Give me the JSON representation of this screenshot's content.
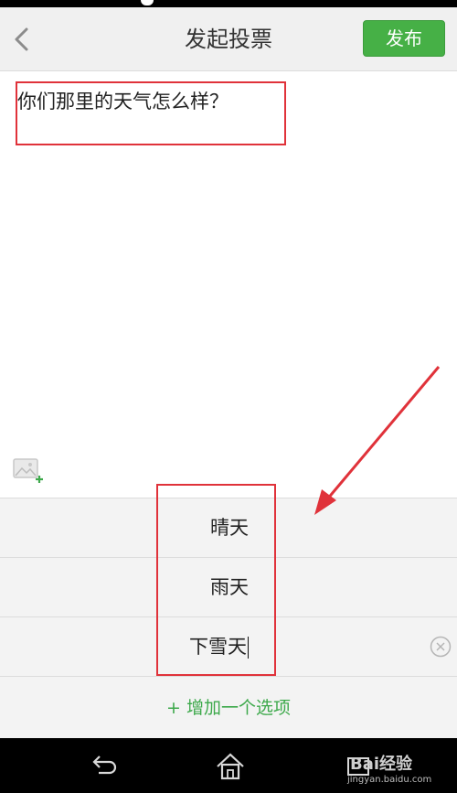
{
  "header": {
    "title": "发起投票",
    "publish_label": "发布"
  },
  "question": {
    "text": "你们那里的天气怎么样？"
  },
  "options": [
    {
      "text": "晴天"
    },
    {
      "text": "雨天"
    },
    {
      "text": "下雪天"
    }
  ],
  "add_option": {
    "label": "+ 增加一个选项"
  },
  "watermark": {
    "brand": "Bai经验",
    "url": "jingyan.baidu.com"
  },
  "colors": {
    "accent_green": "#46b046",
    "annotation_red": "#e0323a"
  },
  "icons": {
    "back": "chevron-left-icon",
    "image_add": "image-add-icon",
    "clear": "clear-circle-icon",
    "nav_back": "nav-back-icon",
    "nav_home": "home-icon",
    "nav_recent": "recent-apps-icon"
  }
}
